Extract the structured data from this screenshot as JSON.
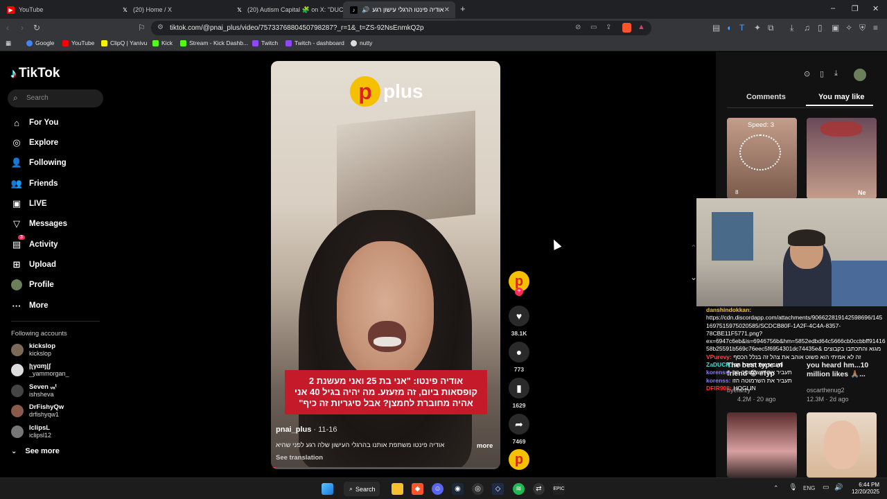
{
  "tabs": [
    {
      "label": "YouTube",
      "icon": "youtube-icon",
      "color": "#ff0000"
    },
    {
      "label": "(20) Home / X",
      "icon": "x-icon",
      "color": "#ffffff"
    },
    {
      "label": "(20) Autism Capital 🧩 on X: \"DUCK",
      "icon": "x-icon",
      "color": "#ffffff"
    },
    {
      "label": "אודיה פינטו הרגלי עישון רגע",
      "icon": "tiktok-icon",
      "color": "#ffffff"
    }
  ],
  "new_tab": "+",
  "window_controls": [
    "–",
    "❐",
    "✕"
  ],
  "url": "tiktok.com/@pnai_plus/video/7573376880450798287?_r=1&_t=ZS-92NsEnmkQ2p",
  "bookmarks": [
    {
      "label": "Google",
      "color": "#4285f4"
    },
    {
      "label": "YouTube",
      "color": "#ff0000"
    },
    {
      "label": "ClipQ | Yanivu",
      "color": "#111111"
    },
    {
      "label": "Kick",
      "color": "#53fc18"
    },
    {
      "label": "Stream - Kick Dashb...",
      "color": "#53fc18"
    },
    {
      "label": "Twitch",
      "color": "#9146ff"
    },
    {
      "label": "Twitch - dashboard",
      "color": "#9146ff"
    },
    {
      "label": "nutty",
      "color": "#dddddd"
    }
  ],
  "tiktok": {
    "logo": "TikTok",
    "search_placeholder": "Search",
    "nav": [
      {
        "label": "For You",
        "icon": "home-icon",
        "glyph": "⌂"
      },
      {
        "label": "Explore",
        "icon": "compass-icon",
        "glyph": "◎"
      },
      {
        "label": "Following",
        "icon": "following-icon",
        "glyph": "👤"
      },
      {
        "label": "Friends",
        "icon": "friends-icon",
        "glyph": "👥"
      },
      {
        "label": "LIVE",
        "icon": "live-icon",
        "glyph": "▣"
      },
      {
        "label": "Messages",
        "icon": "messages-icon",
        "glyph": "▽"
      },
      {
        "label": "Activity",
        "icon": "activity-icon",
        "glyph": "▤"
      },
      {
        "label": "Upload",
        "icon": "upload-icon",
        "glyph": "⊞"
      },
      {
        "label": "Profile",
        "icon": "profile-icon",
        "glyph": "●"
      },
      {
        "label": "More",
        "icon": "more-icon",
        "glyph": "···"
      }
    ],
    "activity_badge": "3",
    "following_header": "Following accounts",
    "accounts": [
      {
        "name": "kickslop",
        "handle": "kickslop",
        "color": "#7c6a58"
      },
      {
        "name": "|ʅγɑɱ|ʃ",
        "handle": "_yammorgan_",
        "color": "#dddddd"
      },
      {
        "name": "Seven ᵥₐᵗ",
        "handle": "ishsheva",
        "color": "#444444"
      },
      {
        "name": "DrFishyQw",
        "handle": "drfishyqw1",
        "color": "#8a5a4a"
      },
      {
        "name": "lclipsL",
        "handle": "iclipsl12",
        "color": "#777777"
      }
    ],
    "see_more": "See more",
    "video": {
      "brand_p": "p",
      "brand_word": "plus",
      "caption": "אודיה פינטו: \"אני בת 25 ואני מעשנת 2 קופסאות ביום, זה מזעזע. מה יהיה בגיל 40 אני אהיה מחוברת לחמצן? אבל סיגריות זה כיף\"",
      "author": "pnai_plus",
      "date": " · 11-16",
      "description": "אודיה פינטו משתפת אותנו בהרגלי העישון שלה רגע לפני שהיא",
      "more": "more",
      "see_translation": "See translation",
      "progress": 0.02
    },
    "actions": {
      "likes": "38.1K",
      "comments": "773",
      "saves": "1629",
      "shares": "7469"
    },
    "right_tabs": [
      "Comments",
      "You may like"
    ],
    "suggested": [
      {
        "overlay": "Speed: 3",
        "count": "8"
      },
      {
        "overlay": "Ne"
      }
    ],
    "suggested_titles": [
      {
        "title": "The best type of friend 😂 #fyp",
        "user": "byefarzy",
        "views": "4.2M",
        "ago": "20 ago"
      },
      {
        "title": "you heard hm...10 million likes 🙏🏽...",
        "user": "oscarthenug2",
        "views": "12.3M",
        "ago": "2d ago"
      }
    ]
  },
  "chat": [
    {
      "user": "danshindokkan:",
      "color": "#f0c040",
      "text": ""
    },
    {
      "user": "",
      "color": "#ffffff",
      "text": "https://cdn.discordapp.com/attachments/906622819142598696/145"
    },
    {
      "user": "",
      "color": "#ffffff",
      "text": "1697515975020585/SCDCB80F-1A2F-4C4A-8357-"
    },
    {
      "user": "",
      "color": "#ffffff",
      "text": "78CBE11F5771.png?"
    },
    {
      "user": "",
      "color": "#ffffff",
      "text": "ex=6947c6eb&is=6946756b&hm=5852edbd64c5666cb0ccbbff91416"
    },
    {
      "user": "",
      "color": "#ffffff",
      "text": "58b25591b569c76eec5f6954301dc74435e& מגוא והתכתבו בקבוצים"
    },
    {
      "user": "VPurevy:",
      "color": "#ff4444",
      "text": " זה לא אמיתי הוא פשוט אוהב את צהל זה בנלל הכסף"
    },
    {
      "user": "ZaDUCK:",
      "color": "#40e0d0",
      "text": " תעביר את הפרה הזו"
    },
    {
      "user": "korenss:",
      "color": "#8a7cff",
      "text": " תעביר את השרמוטה הזו"
    },
    {
      "user": "korenss:",
      "color": "#8a7cff",
      "text": " תעביר את השרמוטה הזו"
    },
    {
      "user": "DFIR908:",
      "color": "#ff3030",
      "text": " HOGLIN"
    }
  ],
  "taskbar": {
    "search": "Search",
    "lang": "ENG",
    "time": "6:44 PM",
    "date": "12/20/2025"
  }
}
